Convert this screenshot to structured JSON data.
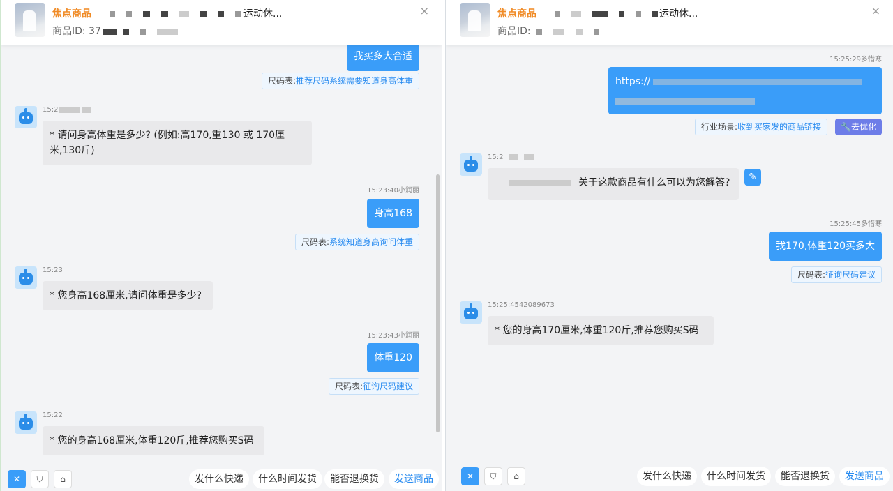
{
  "left": {
    "header": {
      "product_tag": "焦点商品",
      "product_name_suffix": "运动休...",
      "product_id_label": "商品ID:",
      "product_id_visible": "37",
      "close_label": "×"
    },
    "messages": [
      {
        "type": "user",
        "text": "我买多大合适"
      },
      {
        "type": "tag",
        "label": "尺码表:",
        "link": "推荐尺码系统需要知道身高体重"
      },
      {
        "type": "bot",
        "time": "15:2",
        "lines": [
          "* 请问身高体重是多少? (例如:高170,重130 或 170厘",
          "米,130斤)"
        ]
      },
      {
        "type": "user",
        "time": "15:23:40小润丽",
        "text": "身高168"
      },
      {
        "type": "tag",
        "label": "尺码表:",
        "link": "系统知道身高询问体重"
      },
      {
        "type": "bot",
        "time": "15:23",
        "lines": [
          "* 您身高168厘米,请问体重是多少?"
        ]
      },
      {
        "type": "user",
        "time": "15:23:43小润丽",
        "text": "体重120"
      },
      {
        "type": "tag",
        "label": "尺码表:",
        "link": "征询尺码建议"
      },
      {
        "type": "bot",
        "time": "15:22",
        "lines": [
          "* 您的身高168厘米,体重120斤,推荐您购买S码"
        ]
      }
    ],
    "footer": {
      "icons": [
        "close-icon",
        "shield-icon",
        "package-icon"
      ],
      "quick": [
        "发什么快递",
        "什么时间发货",
        "能否退换货",
        "发送商品"
      ]
    }
  },
  "right": {
    "header": {
      "product_tag": "焦点商品",
      "product_name_suffix": "运动休...",
      "product_id_label": "商品ID:",
      "close_label": "×"
    },
    "messages": [
      {
        "type": "user",
        "time": "15:25:29多惜寒",
        "text": "https://"
      },
      {
        "type": "tag",
        "label": "行业场景:",
        "link": "收到买家发的商品链接",
        "action": "去优化"
      },
      {
        "type": "bot",
        "time": "15:2",
        "lines": [
          "关于这款商品有什么可以为您解答?"
        ]
      },
      {
        "type": "user",
        "time": "15:25:45多惜寒",
        "text": "我170,体重120买多大"
      },
      {
        "type": "tag",
        "label": "尺码表:",
        "link": "征询尺码建议"
      },
      {
        "type": "bot",
        "time": "15:25:4542089673",
        "lines": [
          "* 您的身高170厘米,体重120斤,推荐您购买S码"
        ]
      }
    ],
    "footer": {
      "icons": [
        "close-icon",
        "shield-icon",
        "package-icon"
      ],
      "quick": [
        "发什么快递",
        "什么时间发货",
        "能否退换货",
        "发送商品"
      ]
    }
  },
  "colors": {
    "accent": "#3a9df9",
    "product_tag": "#f08a24",
    "link": "#2a8cf0",
    "optimize": "#6d7de8"
  }
}
